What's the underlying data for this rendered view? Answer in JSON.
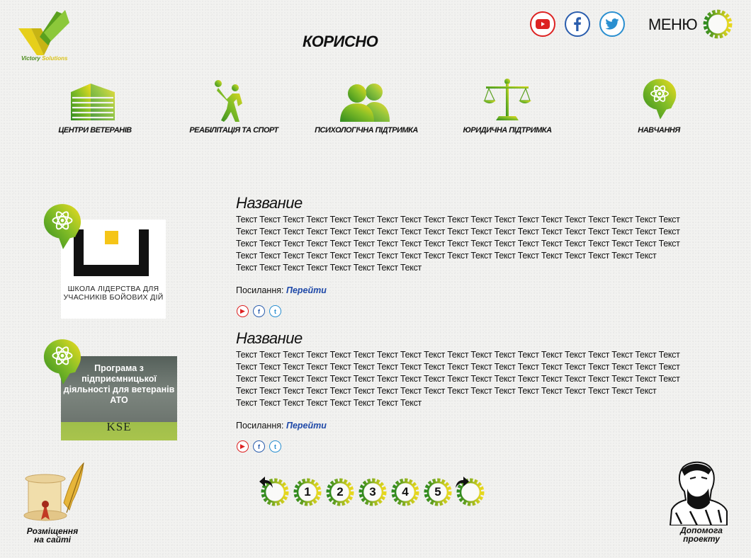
{
  "logo": {
    "word1": "Victory",
    "word2": "Solutions"
  },
  "page_title": "КОРИСНО",
  "header": {
    "menu_label": "МЕНЮ"
  },
  "social": [
    "youtube-icon",
    "facebook-icon",
    "twitter-icon"
  ],
  "categories": [
    {
      "label": "ЦЕНТРИ ВЕТЕРАНІВ",
      "icon": "buildings-icon"
    },
    {
      "label": "РЕАБІЛІТАЦІЯ ТА СПОРТ",
      "icon": "athlete-icon"
    },
    {
      "label": "ПСИХОЛОГІЧНА ПІДТРИМКА",
      "icon": "people-icon"
    },
    {
      "label": "ЮРИДИЧНА ПІДТРИМКА",
      "icon": "scales-icon"
    },
    {
      "label": "НАВЧАННЯ",
      "icon": "head-atom-icon"
    }
  ],
  "entries": [
    {
      "title": "Название",
      "lines": [
        "Текст Текст Текст Текст Текст Текст Текст Текст Текст Текст Текст Текст Текст Текст Текст Текст Текст Текст Текст",
        "Текст Текст Текст Текст Текст Текст Текст Текст Текст Текст Текст Текст Текст Текст Текст Текст Текст Текст Текст",
        "Текст Текст Текст Текст Текст Текст Текст Текст Текст Текст Текст Текст Текст Текст Текст Текст Текст Текст Текст",
        "Текст Текст Текст Текст Текст Текст Текст Текст Текст Текст Текст Текст Текст Текст Текст Текст Текст Текст",
        "Текст Текст Текст Текст Текст Текст Текст Текст"
      ],
      "link_label": "Посилання:",
      "link_text": "Перейти",
      "image_caption": "ШКОЛА ЛІДЕРСТВА ДЛЯ УЧАСНИКІВ БОЙОВИХ ДІЙ"
    },
    {
      "title": "Название",
      "lines": [
        "Текст Текст Текст Текст Текст Текст Текст Текст Текст Текст Текст Текст Текст Текст Текст Текст Текст Текст Текст",
        "Текст Текст Текст Текст Текст Текст Текст Текст Текст Текст Текст Текст Текст Текст Текст Текст Текст Текст Текст",
        "Текст Текст Текст Текст Текст Текст Текст Текст Текст Текст Текст Текст Текст Текст Текст Текст Текст Текст Текст",
        "Текст Текст Текст Текст Текст Текст Текст Текст Текст Текст Текст Текст Текст Текст Текст Текст Текст Текст",
        "Текст Текст Текст Текст Текст Текст Текст Текст"
      ],
      "link_label": "Посилання:",
      "link_text": "Перейти",
      "image_caption": "Програма з підприємницької діяльності для ветеранів АТО",
      "image_brand": "KSE"
    }
  ],
  "pagination": {
    "pages": [
      "1",
      "2",
      "3",
      "4",
      "5"
    ]
  },
  "bottom": {
    "left_label_1": "Розміщення",
    "left_label_2": "на сайті",
    "right_label_1": "Допомога",
    "right_label_2": "проекту"
  },
  "colors": {
    "green": "#5aa01e",
    "yellow": "#e6d21c",
    "link_blue": "#1f49a8"
  }
}
